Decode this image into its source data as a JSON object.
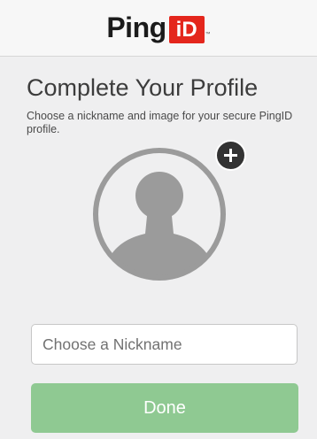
{
  "header": {
    "logo_text": "Ping",
    "logo_badge": "iD",
    "logo_tm": "™"
  },
  "profile": {
    "title": "Complete Your Profile",
    "subtitle": "Choose a nickname and image for your secure PingID profile."
  },
  "avatar": {
    "icon": "user-silhouette-icon",
    "add_icon": "plus-icon"
  },
  "nickname": {
    "value": "",
    "placeholder": "Choose a Nickname"
  },
  "done_button": {
    "label": "Done",
    "state": "disabled"
  },
  "colors": {
    "background": "#efeff0",
    "header_background": "#f7f7f7",
    "brand_red": "#e4261c",
    "avatar_gray": "#9b9b9b",
    "done_green": "#8fc992"
  }
}
